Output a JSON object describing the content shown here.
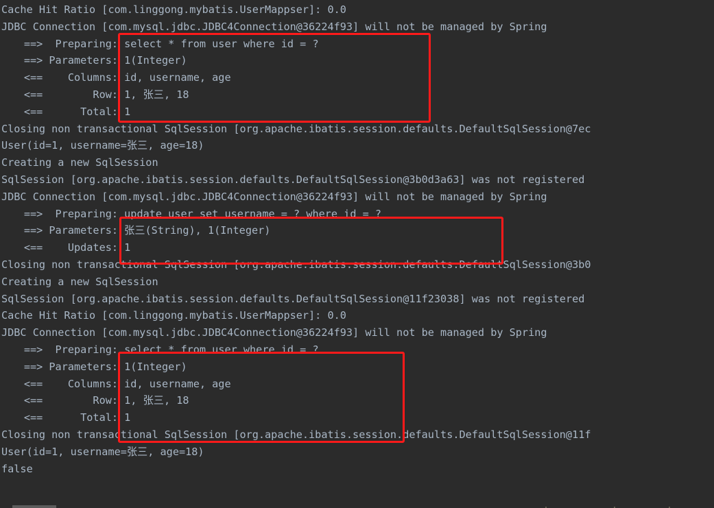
{
  "theme": {
    "background": "#2b2b2b",
    "text": "#a9b7c6",
    "highlight_border": "#ff1a1a"
  },
  "console": {
    "title": "MyBatis SQL console output",
    "lines": [
      {
        "type": "plain",
        "text": "Cache Hit Ratio [com.linggong.mybatis.UserMappser]: 0.0"
      },
      {
        "type": "plain",
        "text": "JDBC Connection [com.mysql.jdbc.JDBC4Connection@36224f93] will not be managed by Spring"
      },
      {
        "type": "kv",
        "label": "==>  Preparing:",
        "value": "select * from user where id = ?"
      },
      {
        "type": "kv",
        "label": "==> Parameters:",
        "value": "1(Integer)"
      },
      {
        "type": "kv",
        "label": "<==    Columns:",
        "value": "id, username, age"
      },
      {
        "type": "kv",
        "label": "<==        Row:",
        "value": "1, 张三, 18"
      },
      {
        "type": "kv",
        "label": "<==      Total:",
        "value": "1"
      },
      {
        "type": "plain",
        "text": "Closing non transactional SqlSession [org.apache.ibatis.session.defaults.DefaultSqlSession@7ec"
      },
      {
        "type": "plain",
        "text": "User(id=1, username=张三, age=18)"
      },
      {
        "type": "plain",
        "text": "Creating a new SqlSession"
      },
      {
        "type": "plain",
        "text": "SqlSession [org.apache.ibatis.session.defaults.DefaultSqlSession@3b0d3a63] was not registered"
      },
      {
        "type": "plain",
        "text": "JDBC Connection [com.mysql.jdbc.JDBC4Connection@36224f93] will not be managed by Spring"
      },
      {
        "type": "kv",
        "label": "==>  Preparing:",
        "value": "update user set username = ? where id = ?"
      },
      {
        "type": "kv",
        "label": "==> Parameters:",
        "value": "张三(String), 1(Integer)"
      },
      {
        "type": "kv",
        "label": "<==    Updates:",
        "value": "1"
      },
      {
        "type": "plain",
        "text": "Closing non transactional SqlSession [org.apache.ibatis.session.defaults.DefaultSqlSession@3b0"
      },
      {
        "type": "plain",
        "text": "Creating a new SqlSession"
      },
      {
        "type": "plain",
        "text": "SqlSession [org.apache.ibatis.session.defaults.DefaultSqlSession@11f23038] was not registered"
      },
      {
        "type": "plain",
        "text": "Cache Hit Ratio [com.linggong.mybatis.UserMappser]: 0.0"
      },
      {
        "type": "plain",
        "text": "JDBC Connection [com.mysql.jdbc.JDBC4Connection@36224f93] will not be managed by Spring"
      },
      {
        "type": "kv",
        "label": "==>  Preparing:",
        "value": "select * from user where id = ?"
      },
      {
        "type": "kv",
        "label": "==> Parameters:",
        "value": "1(Integer)"
      },
      {
        "type": "kv",
        "label": "<==    Columns:",
        "value": "id, username, age"
      },
      {
        "type": "kv",
        "label": "<==        Row:",
        "value": "1, 张三, 18"
      },
      {
        "type": "kv",
        "label": "<==      Total:",
        "value": "1"
      },
      {
        "type": "plain",
        "text": "Closing non transactional SqlSession [org.apache.ibatis.session.defaults.DefaultSqlSession@11f"
      },
      {
        "type": "plain",
        "text": "User(id=1, username=张三, age=18)"
      },
      {
        "type": "plain",
        "text": "false"
      }
    ]
  },
  "annotations": [
    {
      "id": "box-select-1",
      "name": "highlight-box-select-first",
      "covers": "select * from user where id = ? result block"
    },
    {
      "id": "box-update",
      "name": "highlight-box-update",
      "covers": "update user set username = ? where id = ? block"
    },
    {
      "id": "box-select-2",
      "name": "highlight-box-select-second",
      "covers": "second select * from user where id = ? result block"
    }
  ]
}
